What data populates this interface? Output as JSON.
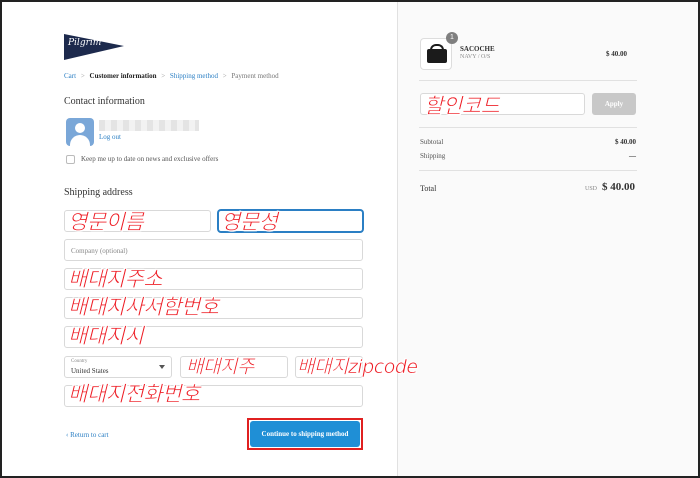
{
  "brand": {
    "logo_text": "Pilgrim"
  },
  "breadcrumb": [
    {
      "label": "Cart",
      "state": "link"
    },
    {
      "label": "Customer information",
      "state": "current"
    },
    {
      "label": "Shipping method",
      "state": "link"
    },
    {
      "label": "Payment method",
      "state": "pending"
    }
  ],
  "breadcrumb_sep": ">",
  "contact": {
    "title": "Contact information",
    "logout": "Log out",
    "newsletter_label": "Keep me up to date on news and exclusive offers"
  },
  "shipping": {
    "title": "Shipping address",
    "company_placeholder": "Company (optional)",
    "country_label": "Country",
    "country_value": "United States"
  },
  "annotations": {
    "first_name": "영문이름",
    "last_name": "영문성",
    "address": "배대지주소",
    "apartment": "배대지사서함번호",
    "city": "배대지시",
    "state": "배대지주",
    "zip": "배대지zipcode",
    "phone": "배대지전화번호",
    "discount": "할인코드"
  },
  "actions": {
    "return": "Return to cart",
    "continue": "Continue to shipping method"
  },
  "summary": {
    "product_name": "SACOCHE",
    "product_variant": "NAVY / O/S",
    "product_price": "$ 40.00",
    "quantity": "1",
    "apply_label": "Apply",
    "subtotal_label": "Subtotal",
    "subtotal_value": "$ 40.00",
    "shipping_label": "Shipping",
    "shipping_value": "—",
    "total_label": "Total",
    "currency": "USD",
    "total_value": "$ 40.00"
  },
  "colors": {
    "accent": "#1f8fd6",
    "link": "#2b7fc4",
    "annotation_red": "#ee1c24",
    "logo_navy": "#1d2a4d"
  }
}
